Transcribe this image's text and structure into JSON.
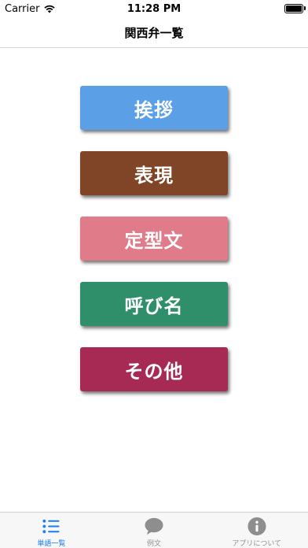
{
  "status_bar": {
    "carrier": "Carrier",
    "time": "11:28 PM"
  },
  "nav": {
    "title": "関西弁一覧"
  },
  "menu": {
    "items": [
      {
        "label": "挨拶",
        "color": "#5B9FE6"
      },
      {
        "label": "表現",
        "color": "#7F4526"
      },
      {
        "label": "定型文",
        "color": "#E07B8A"
      },
      {
        "label": "呼び名",
        "color": "#2E8F6A"
      },
      {
        "label": "その他",
        "color": "#A72A55"
      }
    ]
  },
  "tab_bar": {
    "active_color": "#1A7CF0",
    "inactive_color": "#8E8E8E",
    "tabs": [
      {
        "label": "単語一覧",
        "icon": "list-icon",
        "active": true
      },
      {
        "label": "例文",
        "icon": "speech-bubble-icon",
        "active": false
      },
      {
        "label": "アプリについて",
        "icon": "info-icon",
        "active": false
      }
    ]
  }
}
